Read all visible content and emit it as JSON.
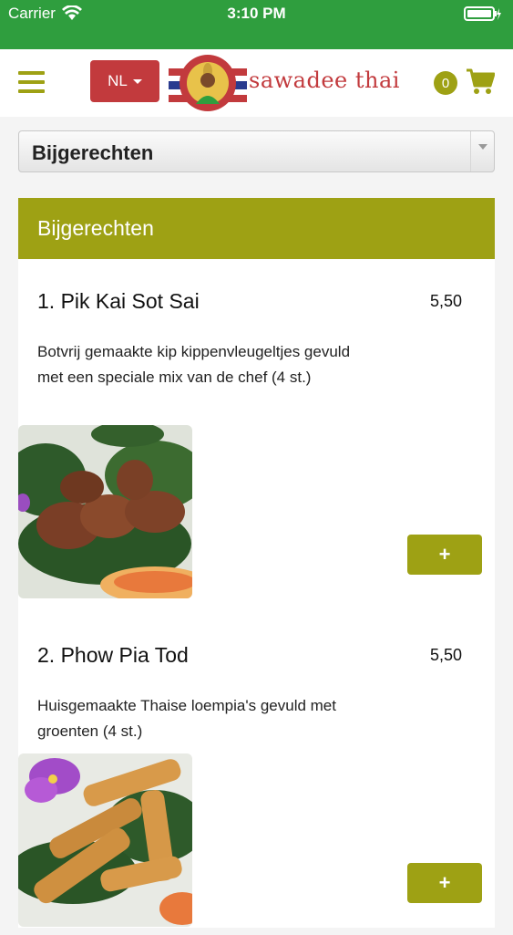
{
  "status_bar": {
    "carrier": "Carrier",
    "time": "3:10 PM"
  },
  "header": {
    "language": "NL",
    "logo_text": "sawadee thai",
    "logo_ring_text": "AFHALEN & BEZORGEN",
    "cart_count": "0"
  },
  "category_select": {
    "value": "Bijgerechten"
  },
  "section": {
    "title": "Bijgerechten",
    "products": [
      {
        "name": "1. Pik Kai Sot Sai",
        "price": "5,50",
        "description": "Botvrij gemaakte kip kippenvleugeltjes gevuld met een speciale mix van de chef (4 st.)",
        "add_label": "+"
      },
      {
        "name": "2. Phow Pia Tod",
        "price": "5,50",
        "description": "Huisgemaakte Thaise loempia's gevuld met groenten (4 st.)",
        "add_label": "+"
      }
    ]
  },
  "colors": {
    "accent": "#9ea114",
    "status_green": "#2f9e3e",
    "brand_red": "#c23a3d"
  }
}
